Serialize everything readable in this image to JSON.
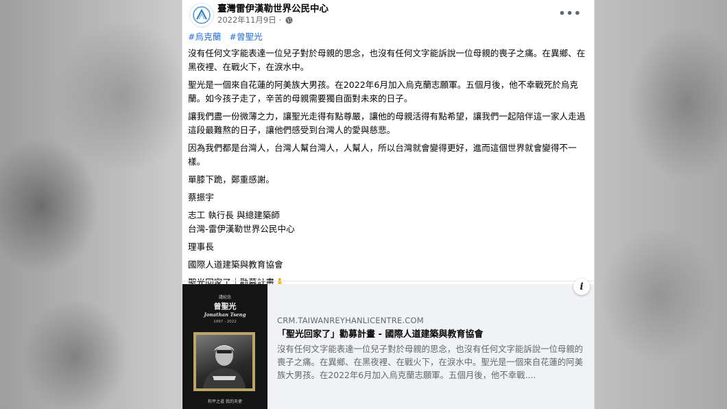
{
  "post": {
    "page_name": "臺灣雷伊漢勒世界公民中心",
    "date": "2022年11月9日",
    "date_separator": "·",
    "more_label": "•••",
    "hashtags": [
      "#烏克蘭",
      "#曾聖光"
    ],
    "paragraphs": [
      "沒有任何文字能表達一位兒子對於母親的思念，也沒有任何文字能訴說一位母親的喪子之痛。在異鄉、在黑夜裡、在戰火下，在淚水中。",
      "聖光是一個來自花蓮的阿美族大男孩。在2022年6月加入烏克蘭志願軍。五個月後，他不幸戰死於烏克蘭。如今孩子走了，辛苦的母親需要獨自面對未來的日子。",
      "讓我們盡一份微薄之力，讓聖光走得有點尊嚴，讓他的母親活得有點希望，讓我們一起陪伴這一家人走過這段最難熬的日子，讓他們感受到台灣人的愛與慈悲。",
      "因為我們都是台灣人，台灣人幫台灣人，人幫人，所以台灣就會變得更好，進而這個世界就會變得不一樣。",
      "單膝下跪，鄭重感謝。",
      "蔡振宇"
    ],
    "signature_line1": "志工 執行長 與總建築師",
    "signature_line2": "台灣-雷伊漢勒世界公民中心",
    "title_line": "理事長",
    "org_line": "國際人道建築與教育協會",
    "closing": "聖光回家了｜勸募計畫🙏",
    "info_label": "i"
  },
  "link_preview": {
    "thumb_small_top": "謹紀念",
    "thumb_name_cn": "曾聖光",
    "thumb_name_en": "Jonathan Tseng",
    "thumb_years": "1997 - 2022",
    "thumb_caption": "和平之道 我的天使",
    "domain": "CRM.TAIWANREYHANLICENTRE.COM",
    "title": "「聖光回家了」勸募計畫 - 國際人道建築與教育協會",
    "description": "沒有任何文字能表達一位兒子對於母親的思念，也沒有任何文字能訴說一位母親的喪子之痛。在異鄉、在黑夜裡、在戰火下，在淚水中。聖光是一個來自花蓮的阿美族大男孩。在2022年6月加入烏克蘭志願軍。五個月後，他不幸戰...."
  },
  "colors": {
    "hashtag": "#216fdb",
    "secondary_text": "#65676b",
    "link_card_bg": "#f0f2f5"
  }
}
